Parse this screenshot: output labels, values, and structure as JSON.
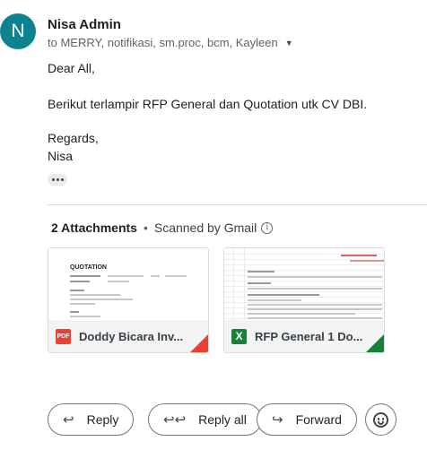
{
  "message": {
    "avatar_letter": "N",
    "avatar_color": "#0b8391",
    "sender": "Nisa Admin",
    "recipients": "to MERRY, notifikasi, sm.proc, bcm, Kayleen",
    "greeting": "Dear All,",
    "line1": "Berikut terlampir RFP General dan Quotation utk CV DBI.",
    "closing": "Regards,",
    "signature": "Nisa"
  },
  "attachments": {
    "count_label": "2 Attachments",
    "separator": "•",
    "scanned_label": "Scanned by Gmail",
    "info_icon_glyph": "i",
    "items": [
      {
        "name": "Doddy Bicara Inv...",
        "type": "pdf",
        "icon_label": "PDF",
        "thumb_title": "QUOTATION",
        "accent": "#e94235"
      },
      {
        "name": "RFP General 1 Do...",
        "type": "xls",
        "icon_label": "X",
        "accent": "#188038"
      }
    ]
  },
  "actions": {
    "reply": "Reply",
    "reply_all": "Reply all",
    "forward": "Forward"
  }
}
